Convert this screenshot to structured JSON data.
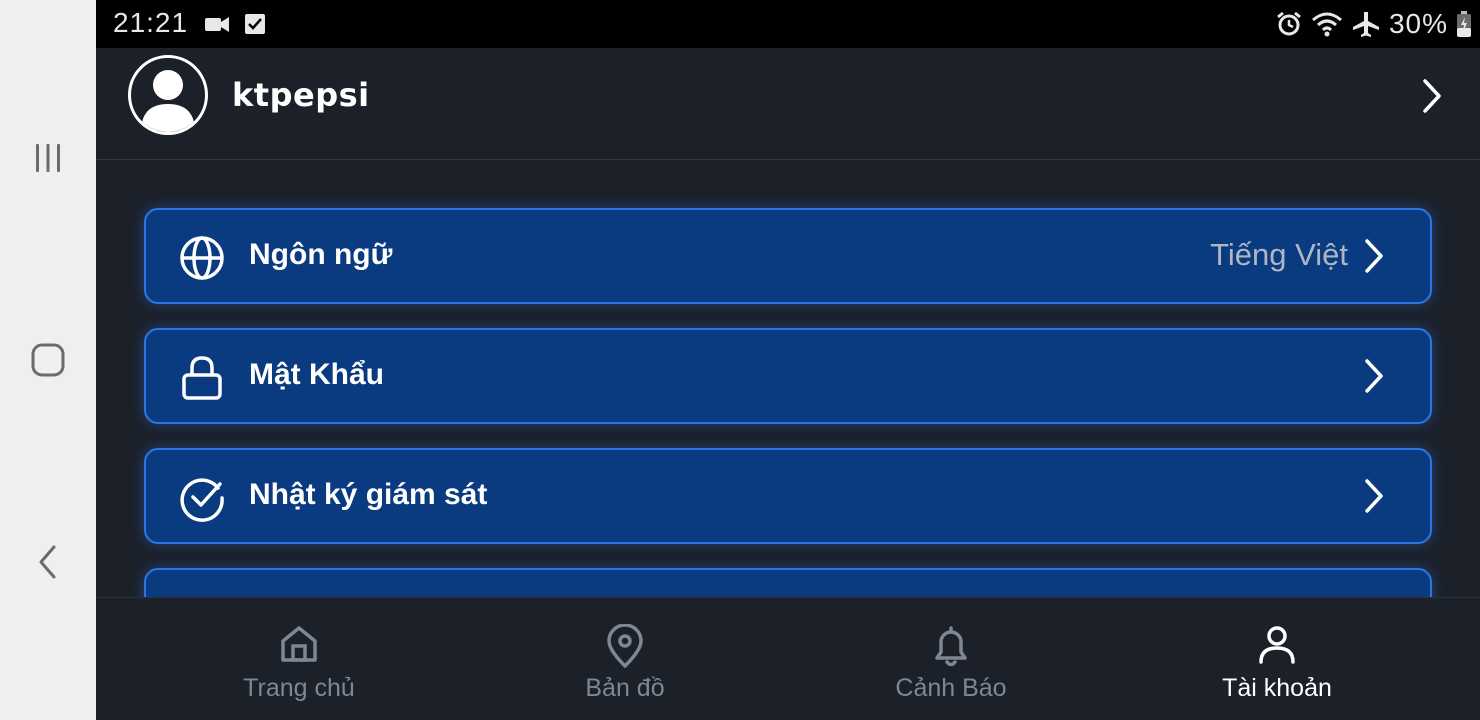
{
  "status_bar": {
    "time": "21:21",
    "battery_text": "30%",
    "left_icons": [
      "video-icon",
      "checkbox-icon"
    ],
    "right_icons": [
      "alarm-icon",
      "wifi-icon",
      "airplane-icon",
      "battery-icon"
    ]
  },
  "system_nav": {
    "items": [
      "recent-apps",
      "home",
      "back"
    ]
  },
  "profile": {
    "username": "ktpepsi"
  },
  "menu": [
    {
      "label": "Ngôn ngữ",
      "value": "Tiếng Việt",
      "icon": "globe-icon"
    },
    {
      "label": "Mật Khẩu",
      "value": "",
      "icon": "lock-icon"
    },
    {
      "label": "Nhật ký giám sát",
      "value": "",
      "icon": "check-circle-icon"
    }
  ],
  "tabs": [
    {
      "label": "Trang chủ",
      "icon": "home-icon",
      "active": false
    },
    {
      "label": "Bản đồ",
      "icon": "map-pin-icon",
      "active": false
    },
    {
      "label": "Cảnh Báo",
      "icon": "bell-icon",
      "active": false
    },
    {
      "label": "Tài khoản",
      "icon": "user-icon",
      "active": true
    }
  ],
  "colors": {
    "background": "#1b2029",
    "card": "#0a3a80",
    "card_border": "#2f74e0",
    "tab_inactive": "#7f8694",
    "tab_active": "#ffffff"
  }
}
